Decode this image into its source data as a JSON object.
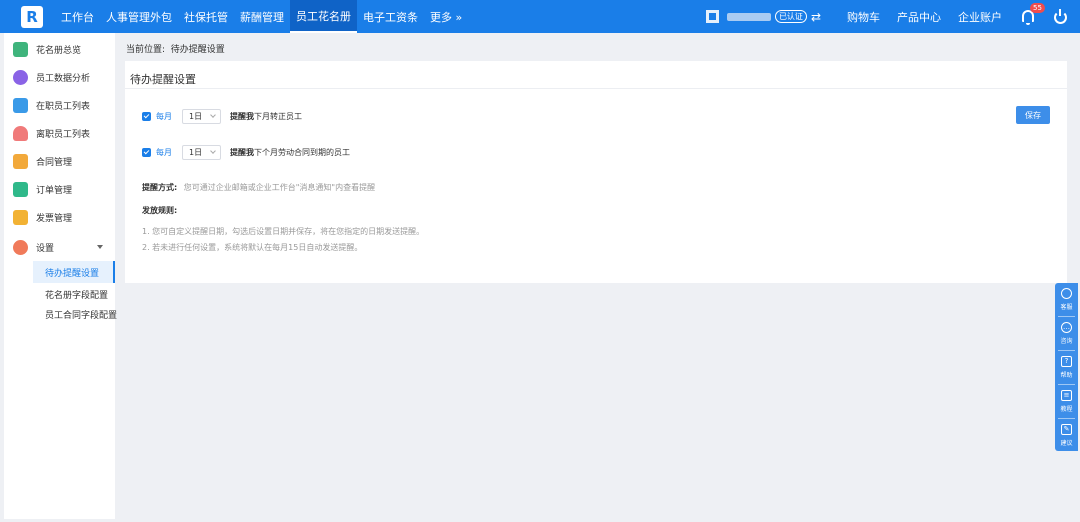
{
  "topbar": {
    "logo": "R",
    "nav": [
      "工作台",
      "人事管理外包",
      "社保托管",
      "薪酬管理",
      "员工花名册",
      "电子工资条",
      "更多 »"
    ],
    "active_index": 4,
    "verify_badge": "已认证",
    "links": [
      "购物车",
      "产品中心",
      "企业账户"
    ],
    "notification_count": "55"
  },
  "sidebar": {
    "items": [
      {
        "label": "花名册总览",
        "color": "#3fb47c"
      },
      {
        "label": "员工数据分析",
        "color": "#8a63e6"
      },
      {
        "label": "在职员工列表",
        "color": "#3a9ae8"
      },
      {
        "label": "离职员工列表",
        "color": "#f07a7a"
      },
      {
        "label": "合同管理",
        "color": "#f2a93b"
      },
      {
        "label": "订单管理",
        "color": "#2fb98a"
      },
      {
        "label": "发票管理",
        "color": "#f2b234"
      },
      {
        "label": "设置",
        "color": "#f07a5a"
      }
    ],
    "sub_items": [
      "待办提醒设置",
      "花名册字段配置",
      "员工合同字段配置"
    ]
  },
  "breadcrumb": {
    "prefix": "当前位置:",
    "current": "待办提醒设置"
  },
  "card": {
    "title": "待办提醒设置",
    "save_label": "保存",
    "rows": [
      {
        "check_label": "每月",
        "select_value": "1日",
        "bold": "提醒我",
        "text": "下月转正员工"
      },
      {
        "check_label": "每月",
        "select_value": "1日",
        "bold": "提醒我",
        "text": "下个月劳动合同到期的员工"
      }
    ],
    "method_label": "提醒方式:",
    "method_text": "您可通过企业邮箱或企业工作台\"消息通知\"内查看提醒",
    "rules_title": "发放规则:",
    "rules": [
      "1. 您可自定义提醒日期，勾选后设置日期并保存，将在您指定的日期发送提醒。",
      "2. 若未进行任何设置，系统将默认在每月15日自动发送提醒。"
    ]
  },
  "float_bar": [
    "客服",
    "咨询",
    "帮助",
    "教程",
    "建议"
  ]
}
